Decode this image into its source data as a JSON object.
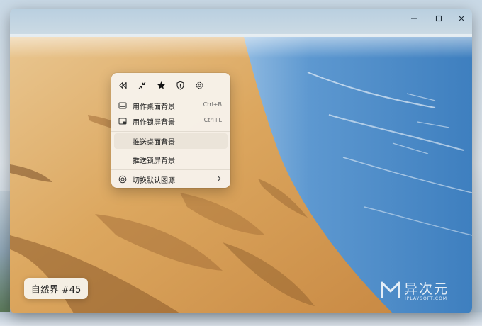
{
  "window": {
    "controls": [
      "minimize-icon",
      "maximize-icon",
      "close-icon"
    ]
  },
  "context_menu": {
    "toolbar_icons": [
      "rewind-icon",
      "collapse-icon",
      "star-icon",
      "shield-icon",
      "gear-icon"
    ],
    "items": [
      {
        "label": "用作桌面背景",
        "shortcut": "Ctrl+B",
        "icon": "desktop-icon"
      },
      {
        "label": "用作锁屏背景",
        "shortcut": "Ctrl+L",
        "icon": "lockscreen-icon"
      },
      {
        "label": "推送桌面背景",
        "shortcut": "",
        "icon": ""
      },
      {
        "label": "推送锁屏背景",
        "shortcut": "",
        "icon": ""
      },
      {
        "label": "切换默认图源",
        "shortcut": "",
        "icon": "source-icon",
        "submenu_icon": "chevron-right-icon"
      }
    ]
  },
  "caption": {
    "text": "自然界 #45"
  },
  "watermark": {
    "title": "异次元",
    "subtitle": "IPLAYSOFT.COM"
  },
  "colors": {
    "menu_bg": "#f7f2ea",
    "sand": "#dca75f",
    "sea": "#4f8cc8"
  }
}
